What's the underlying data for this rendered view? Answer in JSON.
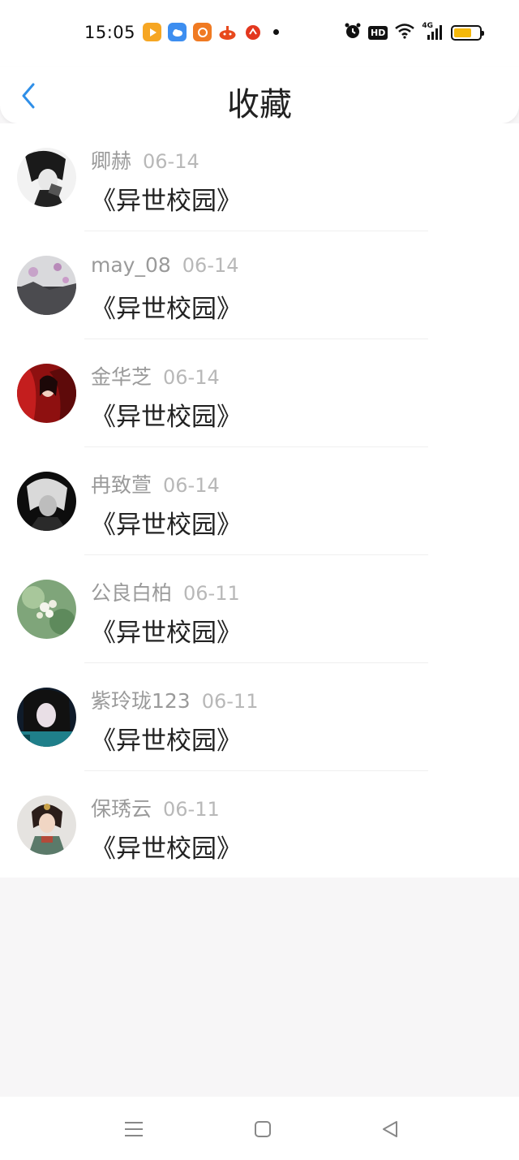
{
  "status_bar": {
    "time": "15:05",
    "app_icons": [
      "video-app-icon",
      "weather-app-icon",
      "orange-app-icon",
      "game-app-icon",
      "red-app-icon"
    ],
    "system_icons": [
      "alarm-icon",
      "hd-icon",
      "wifi-icon",
      "signal-4g-icon",
      "battery-icon"
    ],
    "hd_label": "HD",
    "network_label": "4G",
    "battery_level": 0.7,
    "battery_color": "#f5b80a"
  },
  "header": {
    "title": "收藏",
    "back_icon": "chevron-left-icon",
    "accent_color": "#2f8fe8"
  },
  "favorites": [
    {
      "name": "卿赫",
      "date": "06-14",
      "title": "《异世校园》"
    },
    {
      "name": "may_08",
      "date": "06-14",
      "title": "《异世校园》"
    },
    {
      "name": "金华芝",
      "date": "06-14",
      "title": "《异世校园》"
    },
    {
      "name": "冉致萱",
      "date": "06-14",
      "title": "《异世校园》"
    },
    {
      "name": "公良白柏",
      "date": "06-11",
      "title": "《异世校园》"
    },
    {
      "name": "紫玲珑123",
      "date": "06-11",
      "title": "《异世校园》"
    },
    {
      "name": "保琇云",
      "date": "06-11",
      "title": "《异世校园》"
    }
  ],
  "nav_bar": {
    "buttons": [
      "menu-icon",
      "home-icon",
      "back-triangle-icon"
    ]
  }
}
